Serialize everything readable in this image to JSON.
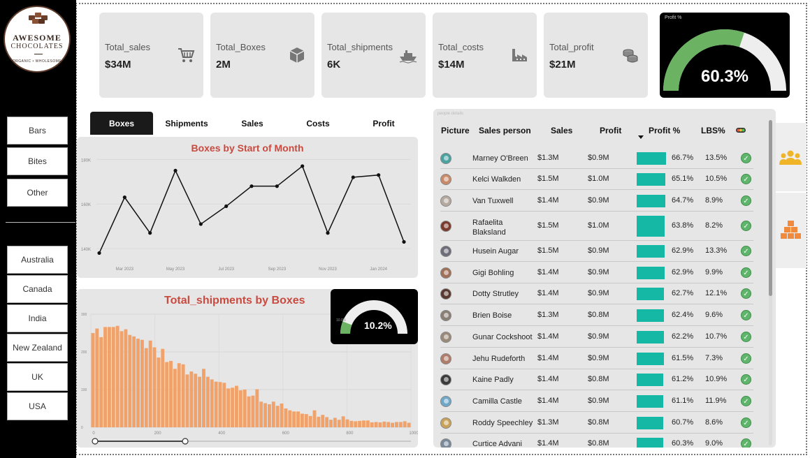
{
  "logo": {
    "line1": "AWESOME",
    "line2": "CHOCOLATES",
    "line3": "ORGANIC • WHOLESOME"
  },
  "categories": [
    "Bars",
    "Bites",
    "Other"
  ],
  "countries": [
    "Australia",
    "Canada",
    "India",
    "New Zealand",
    "UK",
    "USA"
  ],
  "kpis": [
    {
      "label": "Total_sales",
      "value": "$34M",
      "icon": "shopping-cart-icon"
    },
    {
      "label": "Total_Boxes",
      "value": "2M",
      "icon": "box-icon"
    },
    {
      "label": "Total_shipments",
      "value": "6K",
      "icon": "ship-icon"
    },
    {
      "label": "Total_costs",
      "value": "$14M",
      "icon": "factory-icon"
    },
    {
      "label": "Total_profit",
      "value": "$21M",
      "icon": "coins-icon"
    }
  ],
  "profit_gauge": {
    "title": "Profit %",
    "value_text": "60.3%",
    "fraction": 0.603,
    "fill_color": "#6bb363"
  },
  "tabs": [
    "Boxes",
    "Shipments",
    "Sales",
    "Costs",
    "Profit"
  ],
  "active_tab": "Boxes",
  "line_panel": {
    "title": "Boxes by Start of Month"
  },
  "hist_panel": {
    "title": "Total_shipments by Boxes"
  },
  "mini_gauge": {
    "value_text": "10.2%",
    "min_label": "10.0%",
    "fraction": 0.102
  },
  "table": {
    "caption": "people details",
    "headers": {
      "picture": "Picture",
      "sales_person": "Sales person",
      "sales": "Sales",
      "profit": "Profit",
      "profit_pct": "Profit %",
      "lbs_pct": "LBS%"
    },
    "rows": [
      {
        "name": "Marney O'Breen",
        "sales": "$1.3M",
        "profit": "$0.9M",
        "profit_pct": "66.7%",
        "pct_value": 66.7,
        "lbs": "13.5%",
        "avatar_color": "#4aa3a0"
      },
      {
        "name": "Kelci Walkden",
        "sales": "$1.5M",
        "profit": "$1.0M",
        "profit_pct": "65.1%",
        "pct_value": 65.1,
        "lbs": "10.5%",
        "avatar_color": "#c98a6a"
      },
      {
        "name": "Van Tuxwell",
        "sales": "$1.4M",
        "profit": "$0.9M",
        "profit_pct": "64.7%",
        "pct_value": 64.7,
        "lbs": "8.9%",
        "avatar_color": "#b5a9a0"
      },
      {
        "name": "Rafaelita Blaksland",
        "sales": "$1.5M",
        "profit": "$1.0M",
        "profit_pct": "63.8%",
        "pct_value": 63.8,
        "lbs": "8.2%",
        "avatar_color": "#7a3b2e"
      },
      {
        "name": "Husein Augar",
        "sales": "$1.5M",
        "profit": "$0.9M",
        "profit_pct": "62.9%",
        "pct_value": 62.9,
        "lbs": "13.3%",
        "avatar_color": "#6d6d7a"
      },
      {
        "name": "Gigi Bohling",
        "sales": "$1.4M",
        "profit": "$0.9M",
        "profit_pct": "62.9%",
        "pct_value": 62.9,
        "lbs": "9.9%",
        "avatar_color": "#a07058"
      },
      {
        "name": "Dotty Strutley",
        "sales": "$1.4M",
        "profit": "$0.9M",
        "profit_pct": "62.7%",
        "pct_value": 62.7,
        "lbs": "12.1%",
        "avatar_color": "#5a3a30"
      },
      {
        "name": "Brien Boise",
        "sales": "$1.3M",
        "profit": "$0.8M",
        "profit_pct": "62.4%",
        "pct_value": 62.4,
        "lbs": "9.6%",
        "avatar_color": "#8a7f75"
      },
      {
        "name": "Gunar Cockshoot",
        "sales": "$1.4M",
        "profit": "$0.9M",
        "profit_pct": "62.2%",
        "pct_value": 62.2,
        "lbs": "10.7%",
        "avatar_color": "#9a8a7a"
      },
      {
        "name": "Jehu Rudeforth",
        "sales": "$1.4M",
        "profit": "$0.9M",
        "profit_pct": "61.5%",
        "pct_value": 61.5,
        "lbs": "7.3%",
        "avatar_color": "#b07d6a"
      },
      {
        "name": "Kaine Padly",
        "sales": "$1.4M",
        "profit": "$0.8M",
        "profit_pct": "61.2%",
        "pct_value": 61.2,
        "lbs": "10.9%",
        "avatar_color": "#3a3a3a"
      },
      {
        "name": "Camilla Castle",
        "sales": "$1.4M",
        "profit": "$0.9M",
        "profit_pct": "61.1%",
        "pct_value": 61.1,
        "lbs": "11.9%",
        "avatar_color": "#6fa7c8"
      },
      {
        "name": "Roddy Speechley",
        "sales": "$1.3M",
        "profit": "$0.8M",
        "profit_pct": "60.7%",
        "pct_value": 60.7,
        "lbs": "8.6%",
        "avatar_color": "#c9a25a"
      },
      {
        "name": "Curtice Advani",
        "sales": "$1.4M",
        "profit": "$0.8M",
        "profit_pct": "60.3%",
        "pct_value": 60.3,
        "lbs": "9.0%",
        "avatar_color": "#7a8a9a"
      }
    ]
  },
  "colors": {
    "accent_teal": "#15b7a5",
    "title_red": "#c94a3f",
    "hist_orange": "#f0a26a",
    "check_green": "#5fb56b",
    "people_icon": "#f0b429",
    "boxes_icon": "#f08a3c"
  },
  "right_icons": [
    "people-icon",
    "boxes-stack-icon"
  ],
  "chart_data": [
    {
      "type": "line",
      "title": "Boxes by Start of Month",
      "x": [
        "Feb 2023",
        "Mar 2023",
        "Apr 2023",
        "May 2023",
        "Jun 2023",
        "Jul 2023",
        "Aug 2023",
        "Sep 2023",
        "Oct 2023",
        "Nov 2023",
        "Dec 2023",
        "Jan 2024",
        "Feb 2024"
      ],
      "y": [
        138000,
        163000,
        147000,
        175000,
        151000,
        159000,
        168000,
        168000,
        177000,
        147000,
        172000,
        173000,
        143000
      ],
      "x_ticks": [
        "Mar 2023",
        "May 2023",
        "Jul 2023",
        "Sep 2023",
        "Nov 2023",
        "Jan 2024"
      ],
      "y_ticks": [
        "140K",
        "160K",
        "180K"
      ],
      "ylim": [
        135000,
        182000
      ],
      "grid": true
    },
    {
      "type": "bar",
      "title": "Total_shipments by Boxes",
      "x_ticks": [
        "0",
        "200",
        "400",
        "600",
        "800",
        "1000"
      ],
      "y_ticks": [
        "0",
        "100",
        "200",
        "300"
      ],
      "xlim": [
        0,
        1000
      ],
      "ylim": [
        0,
        300
      ],
      "bin_width": 10,
      "values": [
        250,
        262,
        239,
        266,
        266,
        266,
        269,
        255,
        260,
        245,
        241,
        235,
        232,
        210,
        230,
        212,
        185,
        208,
        173,
        176,
        155,
        170,
        167,
        140,
        148,
        142,
        134,
        155,
        134,
        127,
        121,
        120,
        118,
        103,
        105,
        110,
        98,
        100,
        82,
        84,
        101,
        68,
        64,
        61,
        68,
        57,
        63,
        50,
        45,
        42,
        42,
        36,
        35,
        30,
        45,
        28,
        33,
        27,
        20,
        25,
        20,
        29,
        21,
        17,
        16,
        17,
        18,
        18,
        13,
        14,
        13,
        15,
        14,
        12,
        14,
        14,
        16,
        12
      ],
      "grid": true
    }
  ]
}
